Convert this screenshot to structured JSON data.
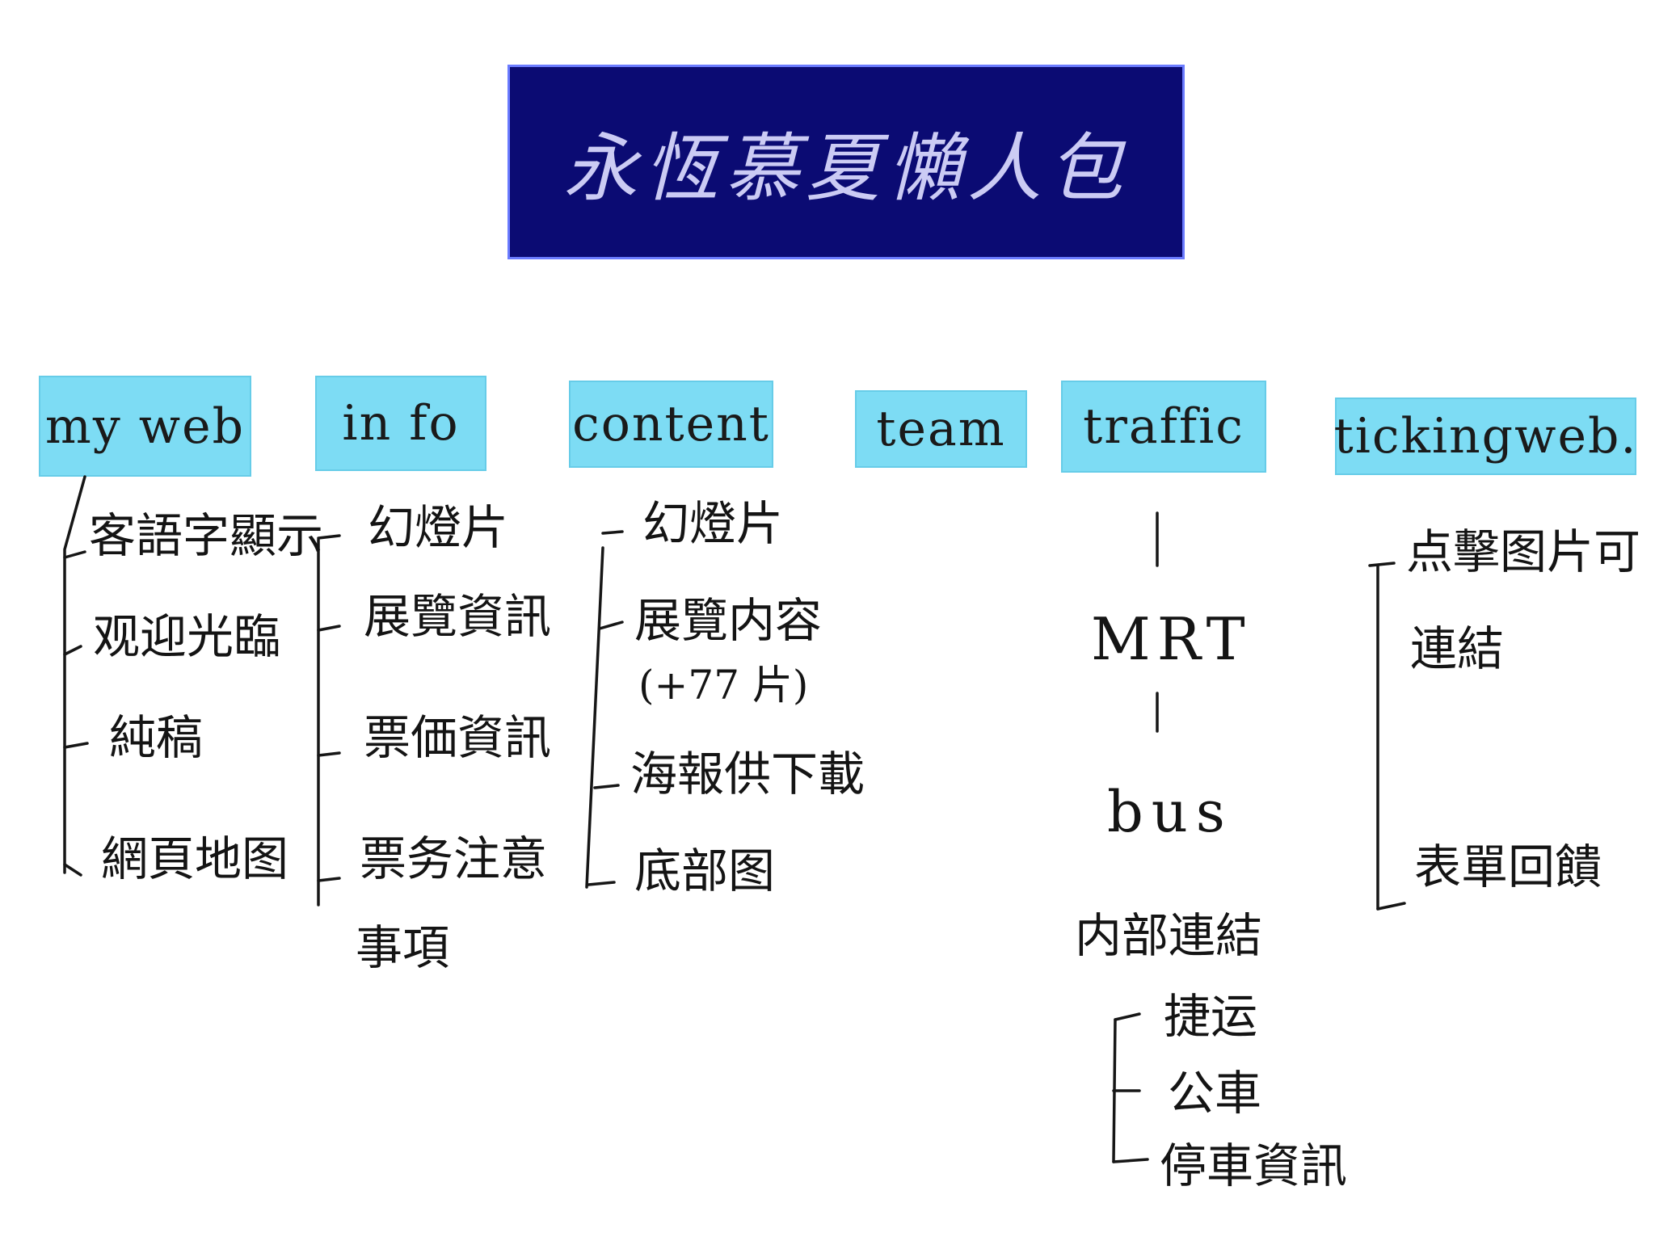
{
  "title": "永恆慕夏懶人包",
  "colors": {
    "title_background": "#0b0b73",
    "title_text": "#dcdcff",
    "category_background": "#7ddcf4",
    "ink": "#141414"
  },
  "categories": [
    {
      "label": "my web",
      "items": [
        "客語字顯示",
        "观迎光臨",
        "純稿",
        "網頁地图"
      ]
    },
    {
      "label": "in fo",
      "items": [
        "幻燈片",
        "展覽資訊",
        "票価資訊",
        "票务注意",
        "事項"
      ]
    },
    {
      "label": "content",
      "items": [
        "幻燈片",
        "展覽内容",
        "(+77 片)",
        "海報供下載",
        "底部图"
      ]
    },
    {
      "label": "team",
      "items": []
    },
    {
      "label": "traffic",
      "items": [
        "MRT",
        "bus",
        "内部連結",
        "捷运",
        "公車",
        "停車資訊"
      ]
    },
    {
      "label": "tickingweb.",
      "items": [
        "点擊图片可",
        "連結",
        "表單回饋"
      ]
    }
  ]
}
